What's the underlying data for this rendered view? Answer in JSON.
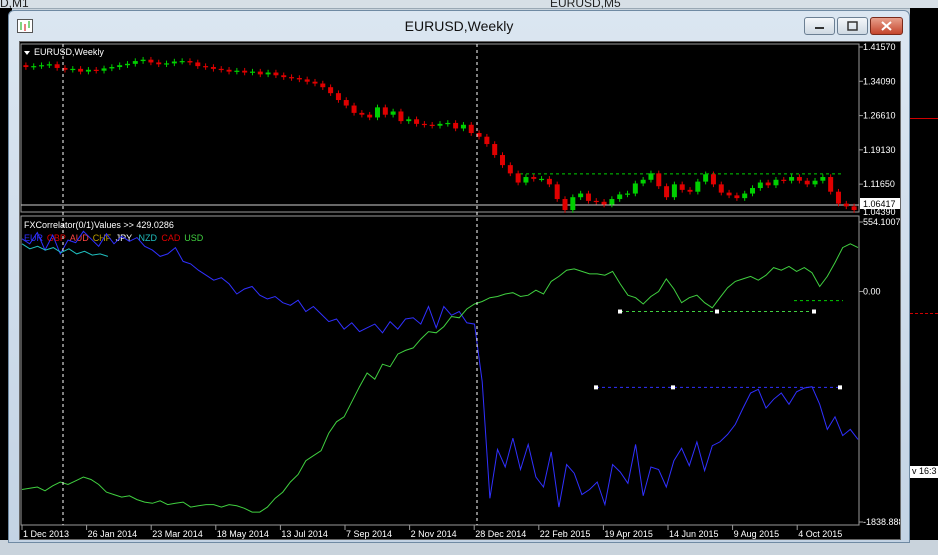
{
  "background": {
    "top_left_label": "D,M1",
    "top_right_label": "EURUSD,M5",
    "right_edge_label": "v 16:3"
  },
  "window": {
    "title": "EURUSD,Weekly",
    "controls": {
      "minimize": "minimize-icon",
      "maximize": "maximize-icon",
      "close": "close-icon"
    }
  },
  "colors": {
    "background": "#000000",
    "bull_candle": "#00d000",
    "bear_candle": "#e00000",
    "eur_line": "#3030ff",
    "usd_line": "#40d040",
    "axis_text": "#ffffff",
    "grid_dashed": "#ffffff"
  },
  "chart_data": [
    {
      "type": "candlestick",
      "label": "EURUSD,Weekly",
      "ylim": [
        1.0339,
        1.4157
      ],
      "y_ticks": [
        "1.41570",
        "1.34090",
        "1.26610",
        "1.19130",
        "1.11650"
      ],
      "current_price": "1.06417",
      "lower_price": "1.04390",
      "close_series": [
        1.372,
        1.374,
        1.376,
        1.378,
        1.37,
        1.366,
        1.368,
        1.362,
        1.366,
        1.364,
        1.369,
        1.372,
        1.376,
        1.379,
        1.385,
        1.388,
        1.382,
        1.378,
        1.38,
        1.384,
        1.385,
        1.382,
        1.374,
        1.372,
        1.368,
        1.366,
        1.362,
        1.364,
        1.36,
        1.362,
        1.356,
        1.36,
        1.354,
        1.35,
        1.348,
        1.345,
        1.34,
        1.336,
        1.328,
        1.315,
        1.3,
        1.288,
        1.272,
        1.268,
        1.262,
        1.284,
        1.268,
        1.275,
        1.254,
        1.258,
        1.248,
        1.246,
        1.244,
        1.248,
        1.25,
        1.238,
        1.246,
        1.228,
        1.22,
        1.204,
        1.18,
        1.158,
        1.14,
        1.12,
        1.132,
        1.128,
        1.128,
        1.116,
        1.084,
        1.06,
        1.088,
        1.096,
        1.08,
        1.078,
        1.072,
        1.084,
        1.094,
        1.096,
        1.118,
        1.126,
        1.14,
        1.112,
        1.088,
        1.116,
        1.104,
        1.1,
        1.122,
        1.138,
        1.116,
        1.098,
        1.092,
        1.086,
        1.096,
        1.108,
        1.12,
        1.114,
        1.126,
        1.124,
        1.132,
        1.124,
        1.116,
        1.124,
        1.132,
        1.1,
        1.074,
        1.068,
        1.06
      ],
      "levels": [
        {
          "price": 1.139,
          "style": "dashed",
          "color": "#00d000"
        }
      ]
    },
    {
      "type": "line",
      "label": "FXCorrelator(0/1)Values >> 429.0286",
      "currency_labels": [
        {
          "text": "EUR",
          "color": "#3030ff"
        },
        {
          "text": "GBP",
          "color": "#e00000"
        },
        {
          "text": "AUD",
          "color": "#ff4444"
        },
        {
          "text": "CHF",
          "color": "#c0a000"
        },
        {
          "text": "JPY",
          "color": "#ffffff"
        },
        {
          "text": "NZD",
          "color": "#20c0c0"
        },
        {
          "text": "CAD",
          "color": "#e00000"
        },
        {
          "text": "USD",
          "color": "#40d040"
        }
      ],
      "ylim": [
        -1838.888,
        554.1007
      ],
      "y_ticks": [
        "554.1007",
        "0.00",
        "-1838.888"
      ],
      "x_ticks": [
        "1 Dec 2013",
        "26 Jan 2014",
        "23 Mar 2014",
        "18 May 2014",
        "13 Jul 2014",
        "7 Sep 2014",
        "2 Nov 2014",
        "28 Dec 2014",
        "22 Feb 2015",
        "19 Apr 2015",
        "14 Jun 2015",
        "9 Aug 2015",
        "4 Oct 2015"
      ],
      "series": [
        {
          "name": "EUR",
          "color": "#3030ff",
          "values": [
            420,
            380,
            470,
            330,
            450,
            300,
            410,
            390,
            480,
            420,
            360,
            460,
            380,
            440,
            400,
            430,
            360,
            330,
            280,
            300,
            350,
            240,
            220,
            170,
            130,
            90,
            110,
            60,
            -20,
            20,
            40,
            -30,
            -60,
            -40,
            -90,
            -110,
            -70,
            -160,
            -120,
            -180,
            -240,
            -220,
            -300,
            -250,
            -320,
            -290,
            -260,
            -330,
            -240,
            -300,
            -220,
            -210,
            -260,
            -120,
            -290,
            -120,
            -190,
            -160,
            -250,
            -260,
            -720,
            -1650,
            -1260,
            -1400,
            -1170,
            -1420,
            -1220,
            -1480,
            -1560,
            -1280,
            -1720,
            -1380,
            -1450,
            -1620,
            -1580,
            -1520,
            -1700,
            -1380,
            -1440,
            -1530,
            -1220,
            -1630,
            -1400,
            -1420,
            -1560,
            -1350,
            -1250,
            -1390,
            -1200,
            -1430,
            -1230,
            -1200,
            -1140,
            -1060,
            -930,
            -810,
            -780,
            -930,
            -860,
            -810,
            -900,
            -800,
            -770,
            -760,
            -900,
            -1100,
            -1000,
            -1150,
            -1100,
            -1180
          ]
        },
        {
          "name": "USD",
          "color": "#40d040",
          "values": [
            -1580,
            -1570,
            -1560,
            -1590,
            -1550,
            -1520,
            -1540,
            -1510,
            -1480,
            -1500,
            -1540,
            -1600,
            -1620,
            -1640,
            -1630,
            -1660,
            -1680,
            -1690,
            -1670,
            -1700,
            -1690,
            -1680,
            -1720,
            -1710,
            -1700,
            -1700,
            -1720,
            -1700,
            -1710,
            -1730,
            -1760,
            -1760,
            -1720,
            -1650,
            -1600,
            -1520,
            -1460,
            -1350,
            -1310,
            -1270,
            -1130,
            -1040,
            -1000,
            -880,
            -760,
            -650,
            -700,
            -580,
            -600,
            -500,
            -470,
            -450,
            -380,
            -320,
            -330,
            -280,
            -200,
            -210,
            -140,
            -100,
            -80,
            -50,
            -40,
            -20,
            -10,
            -40,
            -30,
            10,
            -20,
            80,
            120,
            170,
            180,
            160,
            140,
            140,
            130,
            160,
            60,
            -30,
            -50,
            -100,
            -40,
            0,
            100,
            20,
            -90,
            -50,
            -30,
            -90,
            -130,
            -50,
            30,
            80,
            100,
            120,
            90,
            130,
            190,
            170,
            200,
            160,
            190,
            150,
            40,
            120,
            230,
            350,
            380,
            350
          ]
        },
        {
          "name": "NZD",
          "color": "#20c0c0",
          "values": [
            380,
            340,
            360,
            330,
            350,
            310,
            340,
            300,
            320,
            290,
            300,
            280
          ]
        }
      ],
      "levels": [
        {
          "value": -73,
          "style": "dashed",
          "color": "#00d000"
        },
        {
          "value": -160,
          "style": "dashed",
          "color": "#40d040"
        },
        {
          "value": -765,
          "style": "dashed",
          "color": "#3030ff"
        }
      ]
    }
  ]
}
